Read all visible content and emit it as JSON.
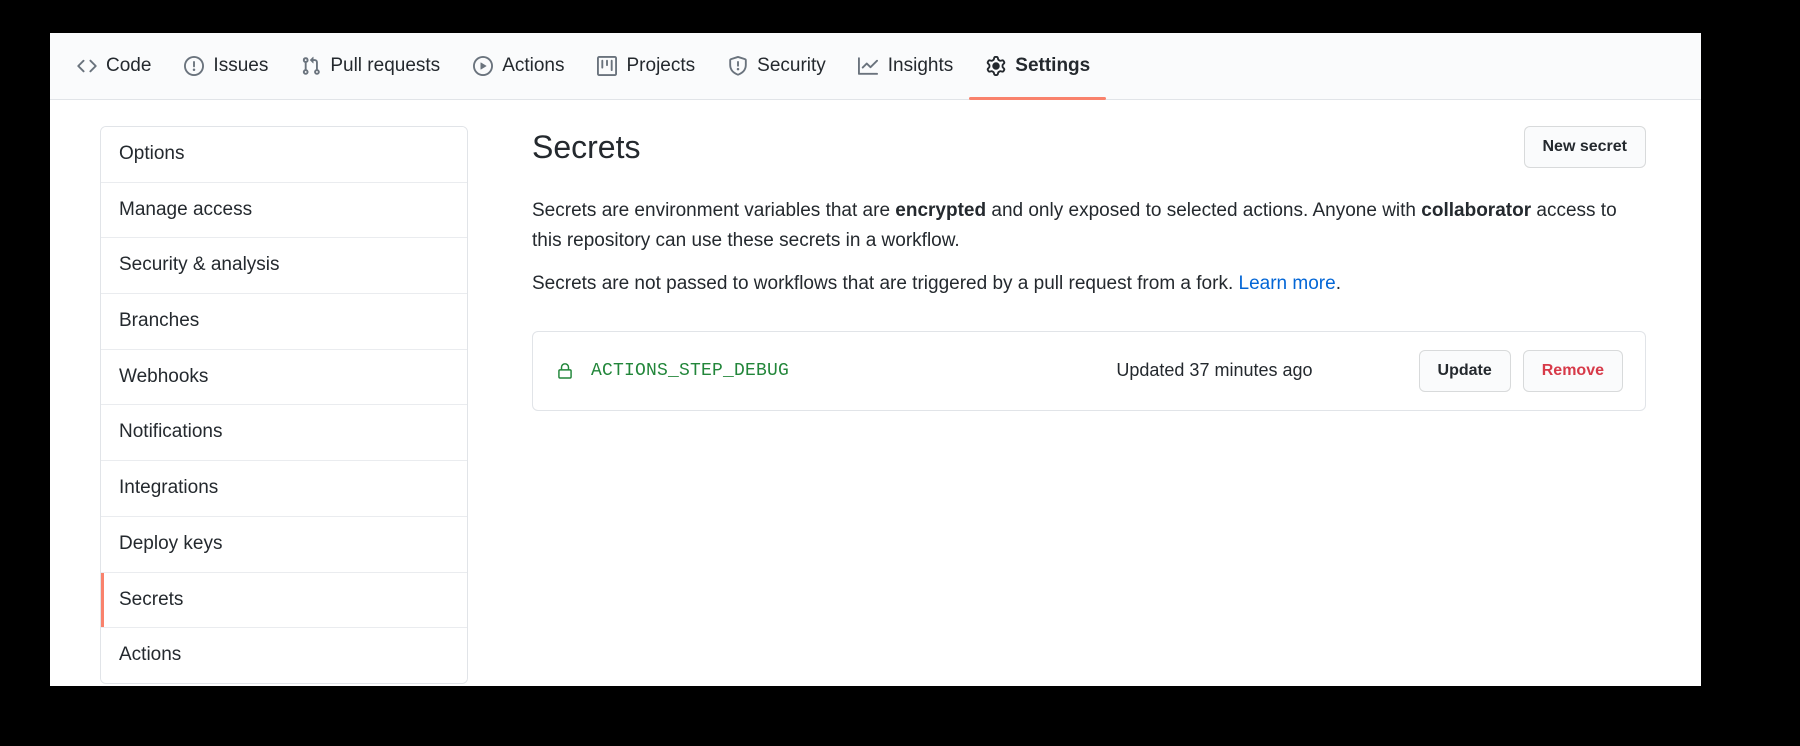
{
  "repo_nav": {
    "items": [
      {
        "label": "Code",
        "icon": "code-icon",
        "selected": false
      },
      {
        "label": "Issues",
        "icon": "issue-opened-icon",
        "selected": false
      },
      {
        "label": "Pull requests",
        "icon": "git-pull-request-icon",
        "selected": false
      },
      {
        "label": "Actions",
        "icon": "play-icon",
        "selected": false
      },
      {
        "label": "Projects",
        "icon": "project-icon",
        "selected": false
      },
      {
        "label": "Security",
        "icon": "shield-icon",
        "selected": false
      },
      {
        "label": "Insights",
        "icon": "graph-icon",
        "selected": false
      },
      {
        "label": "Settings",
        "icon": "gear-icon",
        "selected": true
      }
    ],
    "selected_underline_color": "#f9826c"
  },
  "sidebar": {
    "items": [
      {
        "label": "Options",
        "selected": false
      },
      {
        "label": "Manage access",
        "selected": false
      },
      {
        "label": "Security & analysis",
        "selected": false
      },
      {
        "label": "Branches",
        "selected": false
      },
      {
        "label": "Webhooks",
        "selected": false
      },
      {
        "label": "Notifications",
        "selected": false
      },
      {
        "label": "Integrations",
        "selected": false
      },
      {
        "label": "Deploy keys",
        "selected": false
      },
      {
        "label": "Secrets",
        "selected": true
      },
      {
        "label": "Actions",
        "selected": false
      }
    ],
    "selected_marker_color": "#f9826c"
  },
  "main": {
    "title": "Secrets",
    "new_secret_button": "New secret",
    "description": {
      "p1_part1": "Secrets are environment variables that are ",
      "p1_bold1": "encrypted",
      "p1_part2": " and only exposed to selected actions. Anyone with ",
      "p1_bold2": "collaborator",
      "p1_part3": " access to this repository can use these secrets in a workflow.",
      "p2_text": "Secrets are not passed to workflows that are triggered by a pull request from a fork. ",
      "p2_link": "Learn more",
      "p2_period": "."
    },
    "secrets": [
      {
        "icon": "lock-icon",
        "name": "ACTIONS_STEP_DEBUG",
        "updated": "Updated 37 minutes ago",
        "update_button": "Update",
        "remove_button": "Remove"
      }
    ]
  },
  "colors": {
    "accent_orange": "#f9826c",
    "link_blue": "#0366d6",
    "secret_green": "#22863a",
    "danger_red": "#d73a49",
    "text": "#24292e",
    "border": "#e1e4e8",
    "nav_bg": "#fafbfc"
  }
}
